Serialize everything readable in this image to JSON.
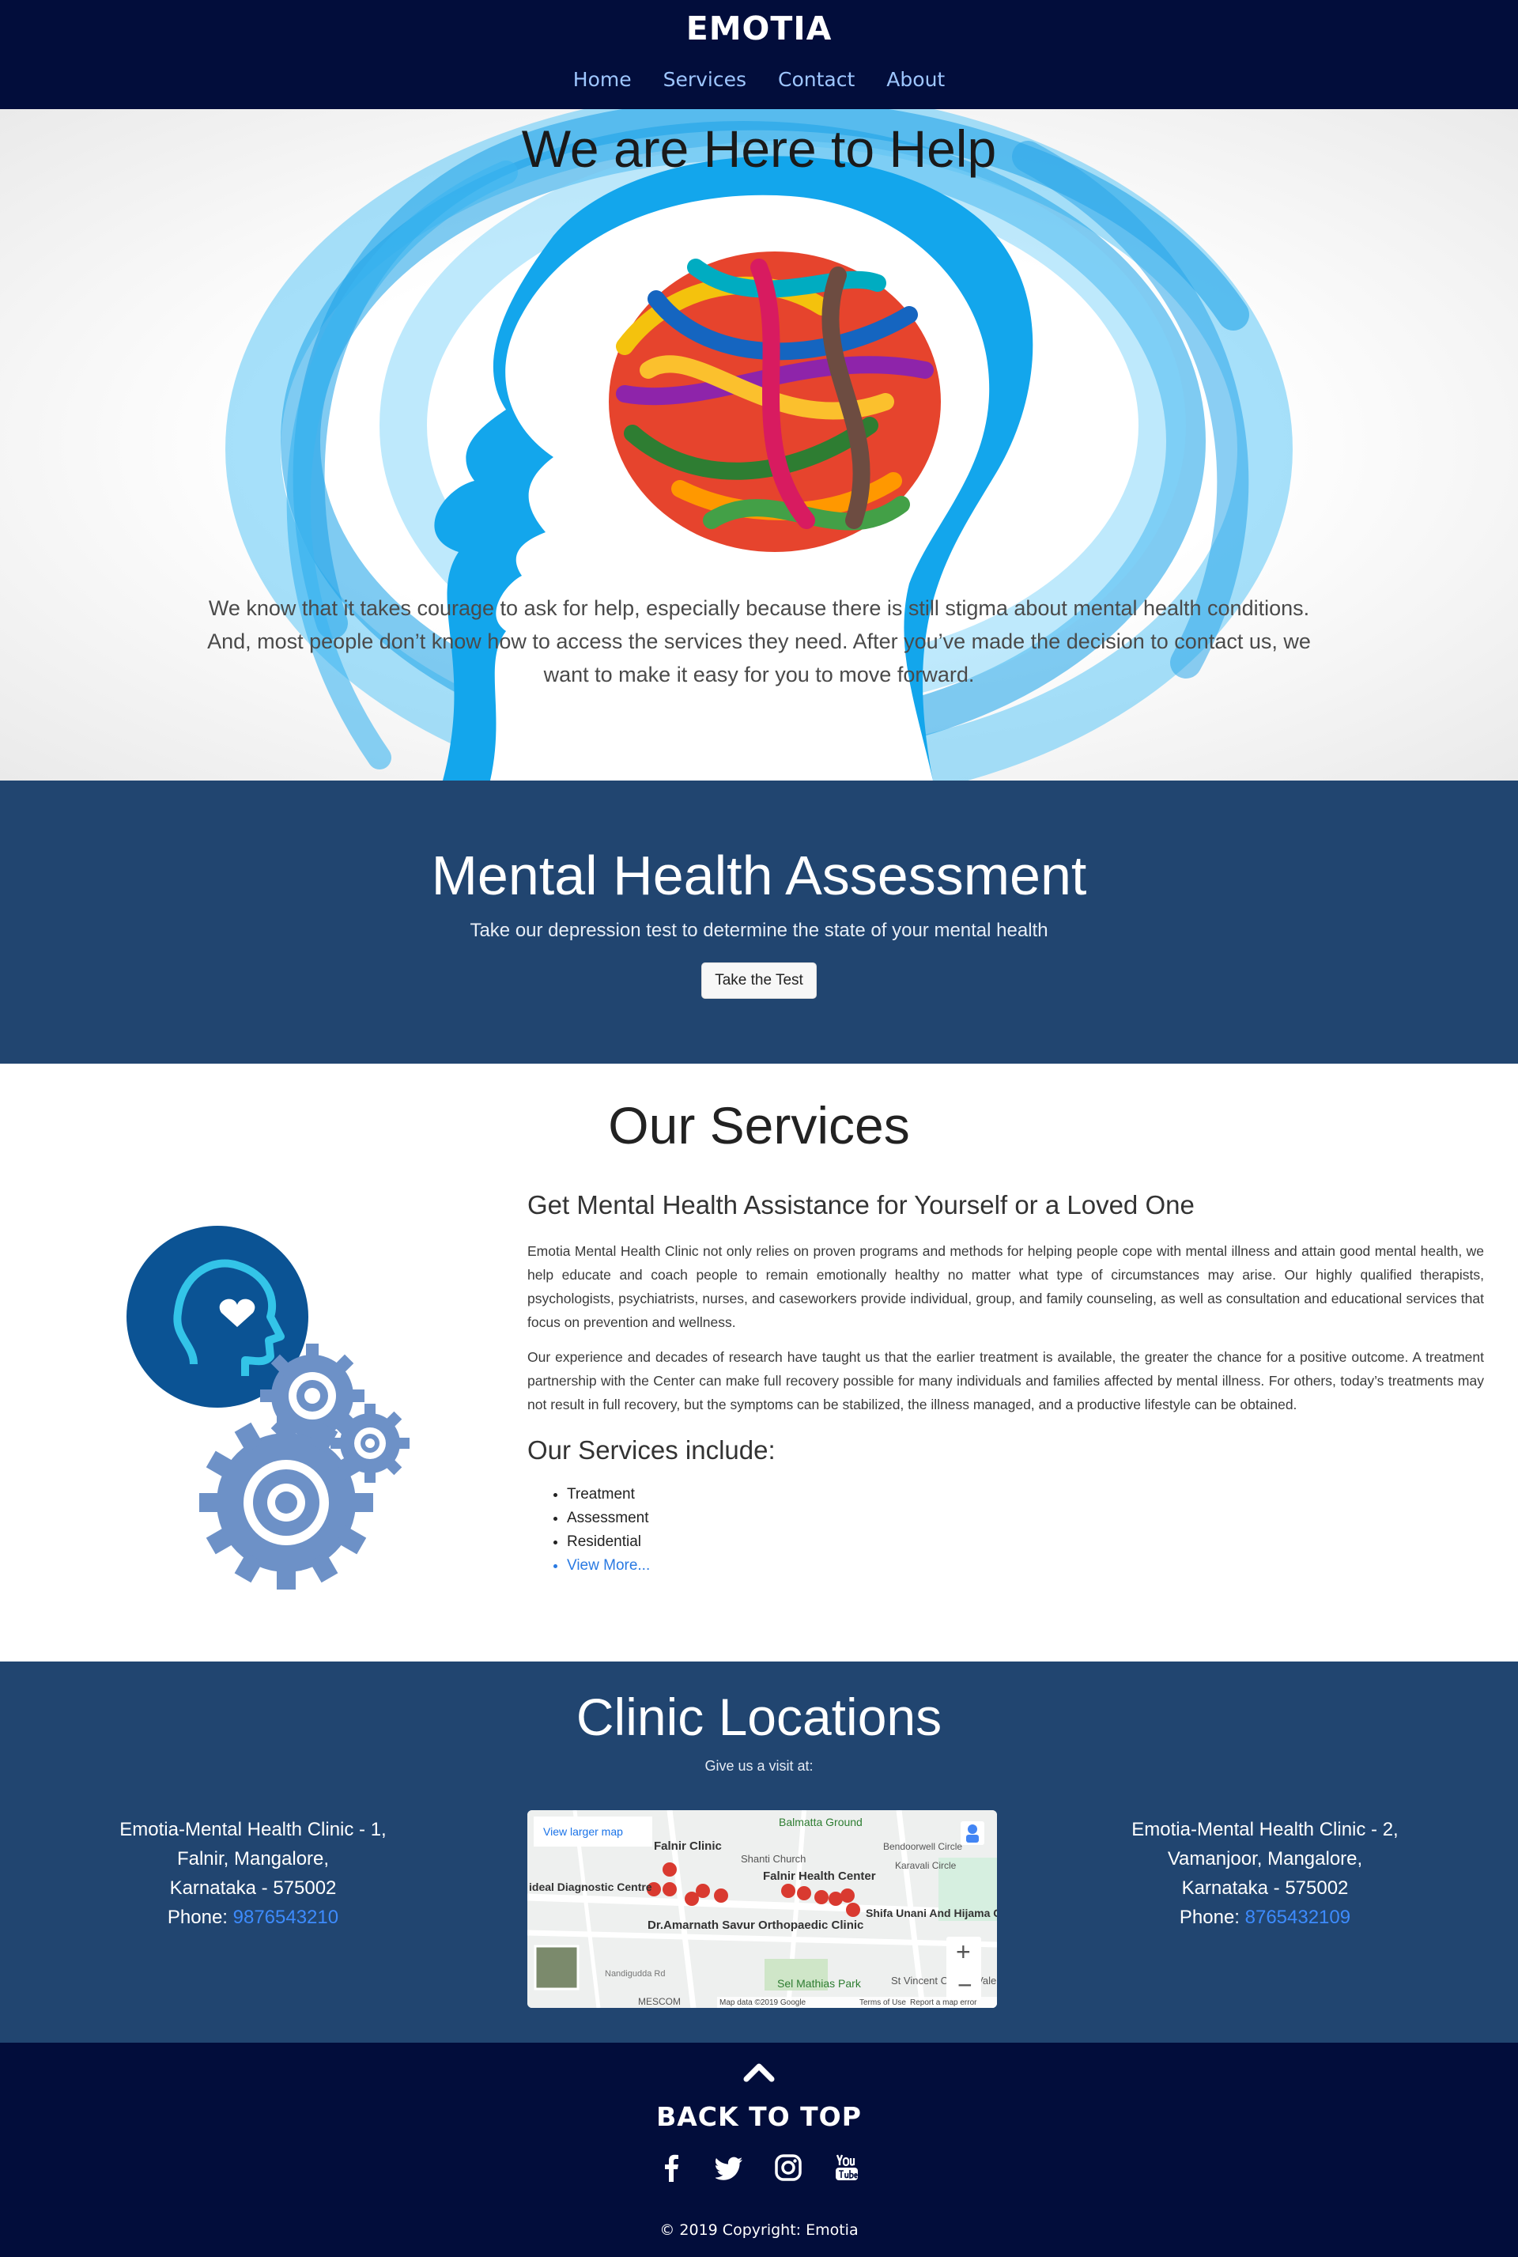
{
  "nav": {
    "brand": "EMOTIA",
    "links": [
      "Home",
      "Services",
      "Contact",
      "About"
    ]
  },
  "hero": {
    "title": "We are Here to Help",
    "text": "We know that it takes courage to ask for help, especially because there is still stigma about mental health conditions. And, most people don’t know how to access the services they need. After you’ve made the decision to contact us, we want to make it easy for you to move forward."
  },
  "assessment": {
    "title": "Mental Health Assessment",
    "subtitle": "Take our depression test to determine the state of your mental health",
    "button": "Take the Test"
  },
  "services": {
    "title": "Our Services",
    "heading": "Get Mental Health Assistance for Yourself or a Loved One",
    "para1": "Emotia Mental Health Clinic not only relies on proven programs and methods for helping people cope with mental illness and attain good mental health, we help educate and coach people to remain emotionally healthy no matter what type of circumstances may arise. Our highly qualified therapists, psychologists, psychiatrists, nurses, and caseworkers provide individual, group, and family counseling, as well as consultation and educational services that focus on prevention and wellness.",
    "para2": "Our experience and decades of research have taught us that the earlier treatment is available, the greater the chance for a positive outcome. A treatment partnership with the Center can make full recovery possible for many individuals and families affected by mental illness. For others, today’s treatments may not result in full recovery, but the symptoms can be stabilized, the illness managed, and a productive lifestyle can be obtained.",
    "list_heading": "Our Services include:",
    "list": [
      "Treatment",
      "Assessment",
      "Residential"
    ],
    "more": "View More..."
  },
  "locations": {
    "title": "Clinic Locations",
    "subtitle": "Give us a visit at:",
    "clinic1": {
      "name": "Emotia-Mental Health Clinic - 1,",
      "area": "Falnir, Mangalore,",
      "state": "Karnataka - 575002",
      "phone_label": "Phone: ",
      "phone": "9876543210"
    },
    "clinic2": {
      "name": "Emotia-Mental Health Clinic - 2,",
      "area": "Vamanjoor, Mangalore,",
      "state": "Karnataka - 575002",
      "phone_label": "Phone: ",
      "phone": "8765432109"
    },
    "map": {
      "larger": "View larger map",
      "place1": "Falnir Clinic",
      "place2": "Balmatta Ground",
      "place3": "Shanti Church",
      "place4": "Falnir Health Center",
      "place5": "Dr.Amarnath Savur Orthopaedic Clinic",
      "place6": "Shifa Unani And Hijama Clinic",
      "place7": "St Vincent Church Valencia",
      "place8": "Bendoorwell Circle",
      "place9": "Karavali Circle",
      "place10": "ideal Diagnostic Centre",
      "place11": "Sel Mathias Park",
      "place12": "MESCOM",
      "place13": "Nandigudda Rd",
      "footer": "Map data ©2019 Google",
      "terms": "Terms of Use",
      "report": "Report a map error",
      "zoom_in": "+",
      "zoom_out": "−"
    }
  },
  "footer": {
    "back_to_top": "BACK TO TOP",
    "copyright": "© 2019 Copyright: Emotia"
  },
  "colors": {
    "nav_bg": "#020d3b",
    "section_bg": "#214570",
    "link": "#3d8bfd"
  }
}
